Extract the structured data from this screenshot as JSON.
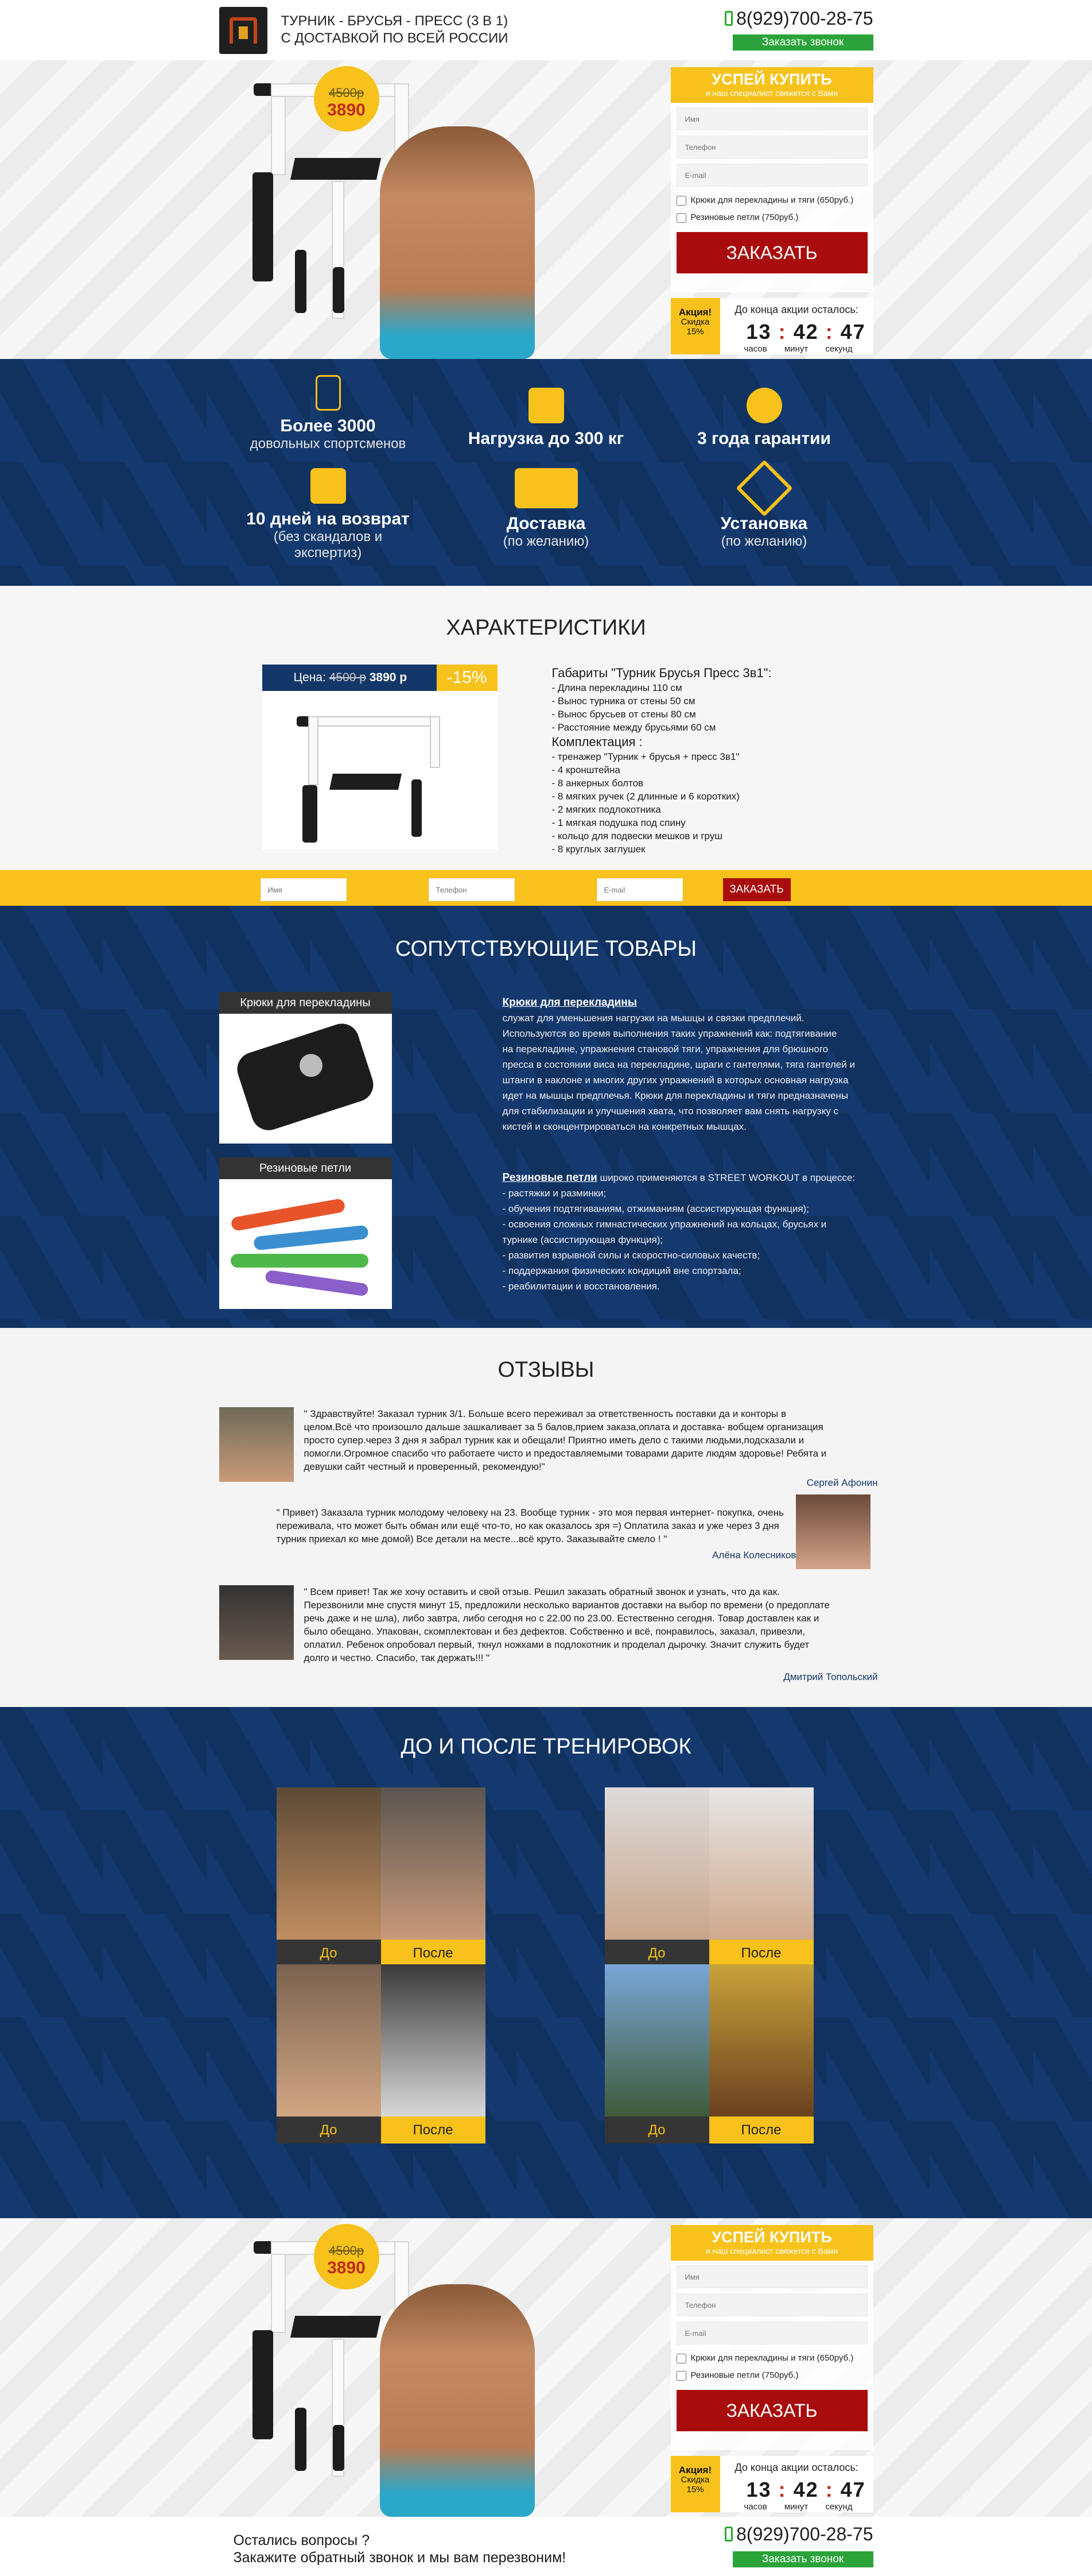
{
  "header": {
    "title_line1": "ТУРНИК - БРУСЬЯ - ПРЕСС (3 в 1)",
    "title_line2": "С ДОСТАВКОЙ ПО ВСЕЙ РОССИИ",
    "phone": "8(929)700-28-75",
    "call_button": "Заказать звонок",
    "logo_icon": "pull-up-bar-logo"
  },
  "hero": {
    "old_price": "4500р",
    "new_price": "3890",
    "form_title": "УСПЕЙ КУПИТЬ",
    "form_subtitle": "и наш специалист свяжется с Вами",
    "name_placeholder": "Имя",
    "phone_placeholder": "Телефон",
    "email_placeholder": "E-mail",
    "option1": "Крюки для перекладины и тяги (650руб.)",
    "option2": "Резиновые петли (750руб.)",
    "order_button": "ЗАКАЗАТЬ",
    "promo_title": "Акция!",
    "promo_sub": "Скидка",
    "promo_pct": "15%",
    "timer_label": "До конца акции осталось:",
    "t_hours": "13",
    "t_minutes": "42",
    "t_seconds": "47",
    "u_hours": "часов",
    "u_minutes": "минут",
    "u_seconds": "секунд"
  },
  "features": [
    {
      "title": "Более 3000",
      "sub": "довольных спортсменов",
      "icon": "athlete-icon"
    },
    {
      "title": "Нагрузка до 300 кг",
      "sub": "",
      "icon": "weight-icon"
    },
    {
      "title": "3 года гарантии",
      "sub": "",
      "icon": "medal-icon"
    },
    {
      "title": "10 дней на возврат",
      "sub": "(без скандалов и экспертиз)",
      "icon": "box-icon"
    },
    {
      "title": "Доставка",
      "sub": "(по желанию)",
      "icon": "truck-icon"
    },
    {
      "title": "Установка",
      "sub": "(по желанию)",
      "icon": "tools-icon"
    }
  ],
  "chars": {
    "heading": "ХАРАКТЕРИСТИКИ",
    "price_label": "Цена:",
    "old_price": "4500 р",
    "new_price": "3890 р",
    "discount": "-15%",
    "dims_title": "Габариты \"Турник Брусья Пресс 3в1\":",
    "dims": [
      "- Длина перекладины 110 см",
      "- Вынос турника от стены 50 см",
      "- Вынос брусьев от стены 80 см",
      "- Расстояние между брусьями 60 см"
    ],
    "kit_title": "Комплектация :",
    "kit": [
      "- тренажер \"Турник + брусья + пресс 3в1\"",
      "- 4 кронштейна",
      "- 8 анкерных болтов",
      "- 8 мягких ручек (2 длинные и 6 коротких)",
      "- 2 мягких подлокотника",
      "- 1 мягкая подушка под спину",
      "- кольцо для подвески мешков и груш",
      "- 8 круглых заглушек"
    ]
  },
  "bar": {
    "name_placeholder": "Имя",
    "phone_placeholder": "Телефон",
    "email_placeholder": "E-mail",
    "button": "ЗАКАЗАТЬ"
  },
  "related": {
    "heading": "СОПУТСТВУЮЩИЕ ТОВАРЫ",
    "card1": "Крюки для перекладины",
    "card2": "Резиновые петли",
    "text1_title": "Крюки для перекладины",
    "text1_lines": [
      "служат для уменьшения нагрузки на мышцы и связки предплечий.",
      "Используются во время выполнения таких упражнений как: подтягивание",
      "на перекладине, упражнения становой тяги, упражнения для брюшного",
      "пресса в состоянии виса на перекладине, шраги с гантелями, тяга гантелей и",
      "штанги в наклоне и многих других упражнений в которых основная нагрузка",
      "идет на мышцы предплечья. Крюки для перекладины и тяги предназначены",
      "для стабилизации и улучшения хвата, что позволяет вам снять нагрузку с",
      "кистей и сконцентрироваться на конкретных мышцах."
    ],
    "text2_title": "Резиновые петли",
    "text2_first": " широко применяются в STREET WORKOUT в процессе:",
    "text2_lines": [
      "- растяжки и разминки;",
      "- обучения подтягиваниям, отжиманиям (ассистирующая функция);",
      "- освоения сложных гимнастических упражнений на кольцах, брусьях и",
      "турнике (ассистирующая функция);",
      "- развития взрывной силы и скоростно-силовых качеств;",
      "- поддержания физических кондиций вне спортзала;",
      "- реабилитации и восстановления."
    ]
  },
  "reviews": {
    "heading": "ОТЗЫВЫ",
    "items": [
      {
        "lines": [
          "\" Здравствуйте! Заказал турник 3/1. Больше всего переживал за ответственность поставки да и конторы в",
          "целом.Всё что произошло дальше зашкаливает за 5 балов,прием заказа,оплата и доставка- вобщем организация",
          "просто супер.через 3 дня я забрал турник как и обещали! Приятно иметь дело с такими людьми,подсказали и",
          "помогли.Огромное спасибо что работаете чисто и предоставляемыми товарами дарите людям здоровье! Ребята и",
          "девушки сайт честный и проверенный, рекомендую!\""
        ],
        "name": "Сергей Афонин"
      },
      {
        "lines": [
          "\" Привет) Заказала турник молодому человеку на 23. Вообще турник - это моя первая интернет- покупка, очень",
          "переживала, что может быть обман или ещё что-то, но как оказалось зря =) Оплатила заказ и уже через 3 дня",
          "турник приехал ко мне домой) Все детали на месте...всё круто. Заказывайте смело ! \""
        ],
        "name": "Алёна Колесникова"
      },
      {
        "lines": [
          "\" Всем привет! Так же хочу оставить и свой отзыв. Решил заказать обратный звонок и узнать, что да как.",
          "Перезвонили мне спустя минут 15, предложили несколько вариантов доставки на выбор по времени (о предоплате",
          "речь даже и не шла), либо завтра, либо сегодня но с 22.00 по 23.00. Естественно сегодня. Товар доставлен как и",
          "было обещано. Упакован, скомплектован и без дефектов. Собственно и всё, понравилось, заказал, привезли,",
          "оплатил. Ребенок опробовал первый, ткнул ножками в подлокотник и проделал дырочку. Значит служить будет",
          "долго и честно. Спасибо, так держать!!! \""
        ],
        "name": "Дмитрий Топольский"
      }
    ]
  },
  "before_after": {
    "heading": "ДО И ПОСЛЕ ТРЕНИРОВОК",
    "before": "До",
    "after": "После"
  },
  "footer": {
    "q1": "Остались вопросы ?",
    "q2": "Закажите обратный звонок и мы вам перезвоним!",
    "phone": "8(929)700-28-75",
    "call_button": "Заказать звонок"
  },
  "colors": {
    "navy": "#143769",
    "yellow": "#f7c21b",
    "red": "#a90c0c",
    "green": "#2ba33a"
  }
}
